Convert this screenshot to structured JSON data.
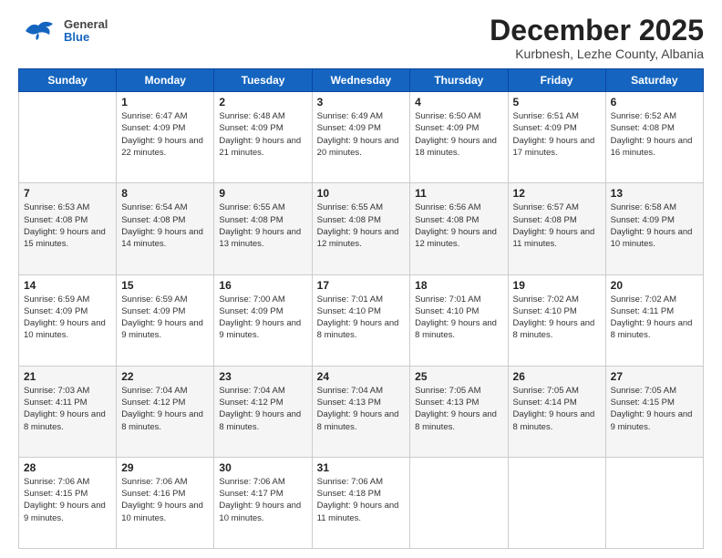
{
  "header": {
    "logo": {
      "general": "General",
      "blue": "Blue"
    },
    "title": "December 2025",
    "location": "Kurbnesh, Lezhe County, Albania"
  },
  "days_of_week": [
    "Sunday",
    "Monday",
    "Tuesday",
    "Wednesday",
    "Thursday",
    "Friday",
    "Saturday"
  ],
  "weeks": [
    [
      {
        "day": "",
        "sunrise": "",
        "sunset": "",
        "daylight": ""
      },
      {
        "day": "1",
        "sunrise": "Sunrise: 6:47 AM",
        "sunset": "Sunset: 4:09 PM",
        "daylight": "Daylight: 9 hours and 22 minutes."
      },
      {
        "day": "2",
        "sunrise": "Sunrise: 6:48 AM",
        "sunset": "Sunset: 4:09 PM",
        "daylight": "Daylight: 9 hours and 21 minutes."
      },
      {
        "day": "3",
        "sunrise": "Sunrise: 6:49 AM",
        "sunset": "Sunset: 4:09 PM",
        "daylight": "Daylight: 9 hours and 20 minutes."
      },
      {
        "day": "4",
        "sunrise": "Sunrise: 6:50 AM",
        "sunset": "Sunset: 4:09 PM",
        "daylight": "Daylight: 9 hours and 18 minutes."
      },
      {
        "day": "5",
        "sunrise": "Sunrise: 6:51 AM",
        "sunset": "Sunset: 4:09 PM",
        "daylight": "Daylight: 9 hours and 17 minutes."
      },
      {
        "day": "6",
        "sunrise": "Sunrise: 6:52 AM",
        "sunset": "Sunset: 4:08 PM",
        "daylight": "Daylight: 9 hours and 16 minutes."
      }
    ],
    [
      {
        "day": "7",
        "sunrise": "Sunrise: 6:53 AM",
        "sunset": "Sunset: 4:08 PM",
        "daylight": "Daylight: 9 hours and 15 minutes."
      },
      {
        "day": "8",
        "sunrise": "Sunrise: 6:54 AM",
        "sunset": "Sunset: 4:08 PM",
        "daylight": "Daylight: 9 hours and 14 minutes."
      },
      {
        "day": "9",
        "sunrise": "Sunrise: 6:55 AM",
        "sunset": "Sunset: 4:08 PM",
        "daylight": "Daylight: 9 hours and 13 minutes."
      },
      {
        "day": "10",
        "sunrise": "Sunrise: 6:55 AM",
        "sunset": "Sunset: 4:08 PM",
        "daylight": "Daylight: 9 hours and 12 minutes."
      },
      {
        "day": "11",
        "sunrise": "Sunrise: 6:56 AM",
        "sunset": "Sunset: 4:08 PM",
        "daylight": "Daylight: 9 hours and 12 minutes."
      },
      {
        "day": "12",
        "sunrise": "Sunrise: 6:57 AM",
        "sunset": "Sunset: 4:08 PM",
        "daylight": "Daylight: 9 hours and 11 minutes."
      },
      {
        "day": "13",
        "sunrise": "Sunrise: 6:58 AM",
        "sunset": "Sunset: 4:09 PM",
        "daylight": "Daylight: 9 hours and 10 minutes."
      }
    ],
    [
      {
        "day": "14",
        "sunrise": "Sunrise: 6:59 AM",
        "sunset": "Sunset: 4:09 PM",
        "daylight": "Daylight: 9 hours and 10 minutes."
      },
      {
        "day": "15",
        "sunrise": "Sunrise: 6:59 AM",
        "sunset": "Sunset: 4:09 PM",
        "daylight": "Daylight: 9 hours and 9 minutes."
      },
      {
        "day": "16",
        "sunrise": "Sunrise: 7:00 AM",
        "sunset": "Sunset: 4:09 PM",
        "daylight": "Daylight: 9 hours and 9 minutes."
      },
      {
        "day": "17",
        "sunrise": "Sunrise: 7:01 AM",
        "sunset": "Sunset: 4:10 PM",
        "daylight": "Daylight: 9 hours and 8 minutes."
      },
      {
        "day": "18",
        "sunrise": "Sunrise: 7:01 AM",
        "sunset": "Sunset: 4:10 PM",
        "daylight": "Daylight: 9 hours and 8 minutes."
      },
      {
        "day": "19",
        "sunrise": "Sunrise: 7:02 AM",
        "sunset": "Sunset: 4:10 PM",
        "daylight": "Daylight: 9 hours and 8 minutes."
      },
      {
        "day": "20",
        "sunrise": "Sunrise: 7:02 AM",
        "sunset": "Sunset: 4:11 PM",
        "daylight": "Daylight: 9 hours and 8 minutes."
      }
    ],
    [
      {
        "day": "21",
        "sunrise": "Sunrise: 7:03 AM",
        "sunset": "Sunset: 4:11 PM",
        "daylight": "Daylight: 9 hours and 8 minutes."
      },
      {
        "day": "22",
        "sunrise": "Sunrise: 7:04 AM",
        "sunset": "Sunset: 4:12 PM",
        "daylight": "Daylight: 9 hours and 8 minutes."
      },
      {
        "day": "23",
        "sunrise": "Sunrise: 7:04 AM",
        "sunset": "Sunset: 4:12 PM",
        "daylight": "Daylight: 9 hours and 8 minutes."
      },
      {
        "day": "24",
        "sunrise": "Sunrise: 7:04 AM",
        "sunset": "Sunset: 4:13 PM",
        "daylight": "Daylight: 9 hours and 8 minutes."
      },
      {
        "day": "25",
        "sunrise": "Sunrise: 7:05 AM",
        "sunset": "Sunset: 4:13 PM",
        "daylight": "Daylight: 9 hours and 8 minutes."
      },
      {
        "day": "26",
        "sunrise": "Sunrise: 7:05 AM",
        "sunset": "Sunset: 4:14 PM",
        "daylight": "Daylight: 9 hours and 8 minutes."
      },
      {
        "day": "27",
        "sunrise": "Sunrise: 7:05 AM",
        "sunset": "Sunset: 4:15 PM",
        "daylight": "Daylight: 9 hours and 9 minutes."
      }
    ],
    [
      {
        "day": "28",
        "sunrise": "Sunrise: 7:06 AM",
        "sunset": "Sunset: 4:15 PM",
        "daylight": "Daylight: 9 hours and 9 minutes."
      },
      {
        "day": "29",
        "sunrise": "Sunrise: 7:06 AM",
        "sunset": "Sunset: 4:16 PM",
        "daylight": "Daylight: 9 hours and 10 minutes."
      },
      {
        "day": "30",
        "sunrise": "Sunrise: 7:06 AM",
        "sunset": "Sunset: 4:17 PM",
        "daylight": "Daylight: 9 hours and 10 minutes."
      },
      {
        "day": "31",
        "sunrise": "Sunrise: 7:06 AM",
        "sunset": "Sunset: 4:18 PM",
        "daylight": "Daylight: 9 hours and 11 minutes."
      },
      {
        "day": "",
        "sunrise": "",
        "sunset": "",
        "daylight": ""
      },
      {
        "day": "",
        "sunrise": "",
        "sunset": "",
        "daylight": ""
      },
      {
        "day": "",
        "sunrise": "",
        "sunset": "",
        "daylight": ""
      }
    ]
  ]
}
